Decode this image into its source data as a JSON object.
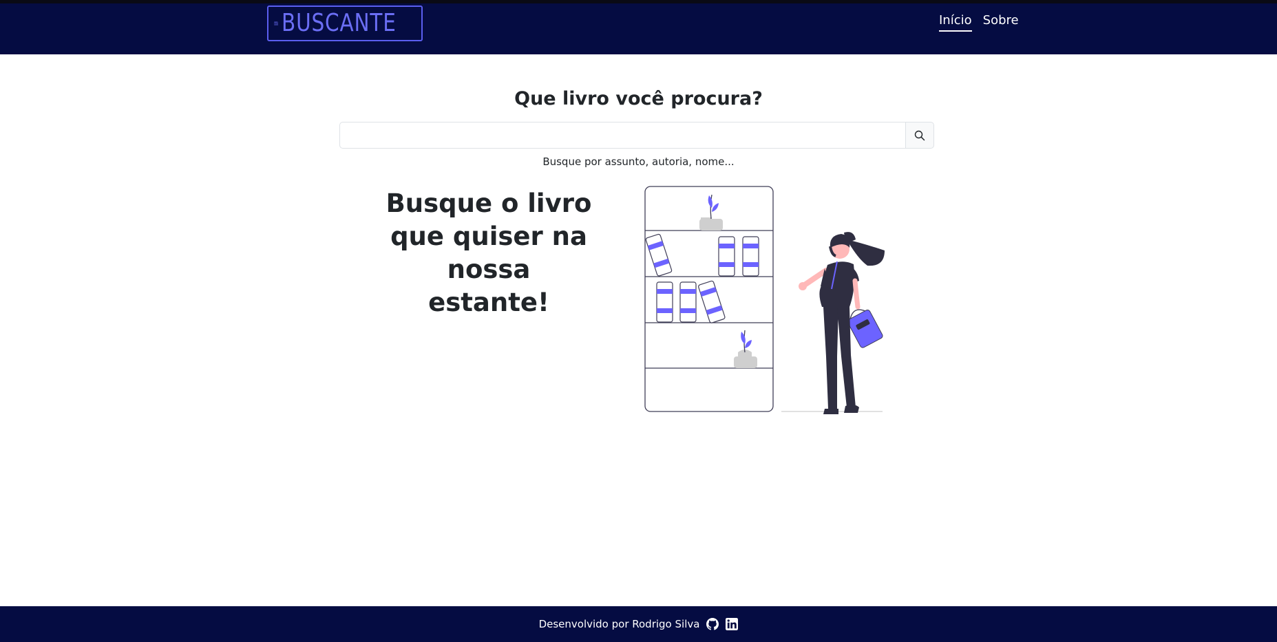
{
  "header": {
    "logo_text": "BUSCANTE",
    "nav": [
      {
        "label": "Início",
        "active": true
      },
      {
        "label": "Sobre",
        "active": false
      }
    ]
  },
  "search": {
    "title": "Que livro você procura?",
    "value": "",
    "placeholder": "",
    "hint": "Busque por assunto, autoria, nome...",
    "button_icon": "search-icon"
  },
  "hero": {
    "text": "Busque o livro que quiser na nossa estante!",
    "illustration": "bookshelf-woman-illustration"
  },
  "footer": {
    "text": "Desenvolvido por Rodrigo Silva",
    "icons": [
      "github-icon",
      "linkedin-icon"
    ]
  },
  "colors": {
    "navbar_bg": "#050c42",
    "accent": "#6c63ff",
    "text": "#212529"
  }
}
